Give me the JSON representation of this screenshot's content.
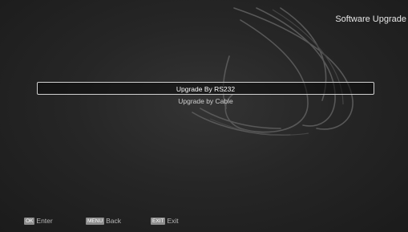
{
  "header": {
    "title": "Software Upgrade"
  },
  "menu": {
    "items": [
      {
        "label": "Upgrade By RS232",
        "selected": true
      },
      {
        "label": "Upgrade by Cable",
        "selected": false
      }
    ]
  },
  "footer": {
    "hints": [
      {
        "key": "OK",
        "label": "Enter"
      },
      {
        "key": "MENU",
        "label": "Back"
      },
      {
        "key": "EXIT",
        "label": "Exit"
      }
    ]
  },
  "colors": {
    "background": "#262626",
    "highlight_border": "#d0d0d0",
    "text": "#e6e6e6",
    "key_badge": "#8e8e8e"
  }
}
